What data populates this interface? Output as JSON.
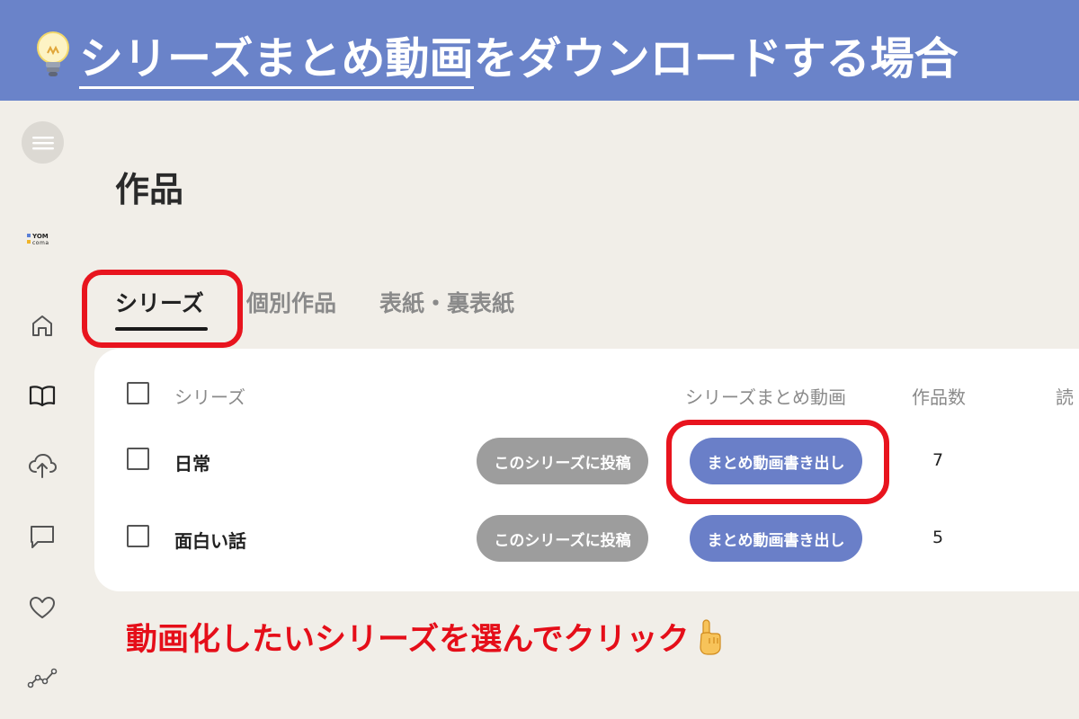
{
  "banner": {
    "underlined": "シリーズまとめ動画",
    "rest": "をダウンロードする場合",
    "bulb_icon": "lightbulb-icon"
  },
  "sidebar": {
    "logo_line1": "YOM",
    "logo_line2": "coma",
    "icons": [
      "menu-icon",
      "home-icon",
      "book-icon",
      "cloud-upload-icon",
      "chat-bubble-icon",
      "heart-icon",
      "analytics-icon"
    ]
  },
  "page": {
    "title": "作品"
  },
  "tabs": [
    {
      "label": "シリーズ",
      "active": true
    },
    {
      "label": "個別作品",
      "active": false
    },
    {
      "label": "表紙・裏表紙",
      "active": false
    }
  ],
  "table": {
    "columns": [
      "シリーズ",
      "シリーズまとめ動画",
      "作品数",
      "読"
    ],
    "rows": [
      {
        "name": "日常",
        "post_label": "このシリーズに投稿",
        "export_label": "まとめ動画書き出し",
        "count": "7"
      },
      {
        "name": "面白い話",
        "post_label": "このシリーズに投稿",
        "export_label": "まとめ動画書き出し",
        "count": "5"
      }
    ]
  },
  "callout": {
    "text": "動画化したいシリーズを選んでクリック",
    "icon": "pointing-hand-icon"
  },
  "colors": {
    "banner": "#6a83c9",
    "background": "#f1eee8",
    "highlight": "#e8141e",
    "button_blue": "#6a7fc8",
    "button_grey": "#9d9d9d"
  }
}
